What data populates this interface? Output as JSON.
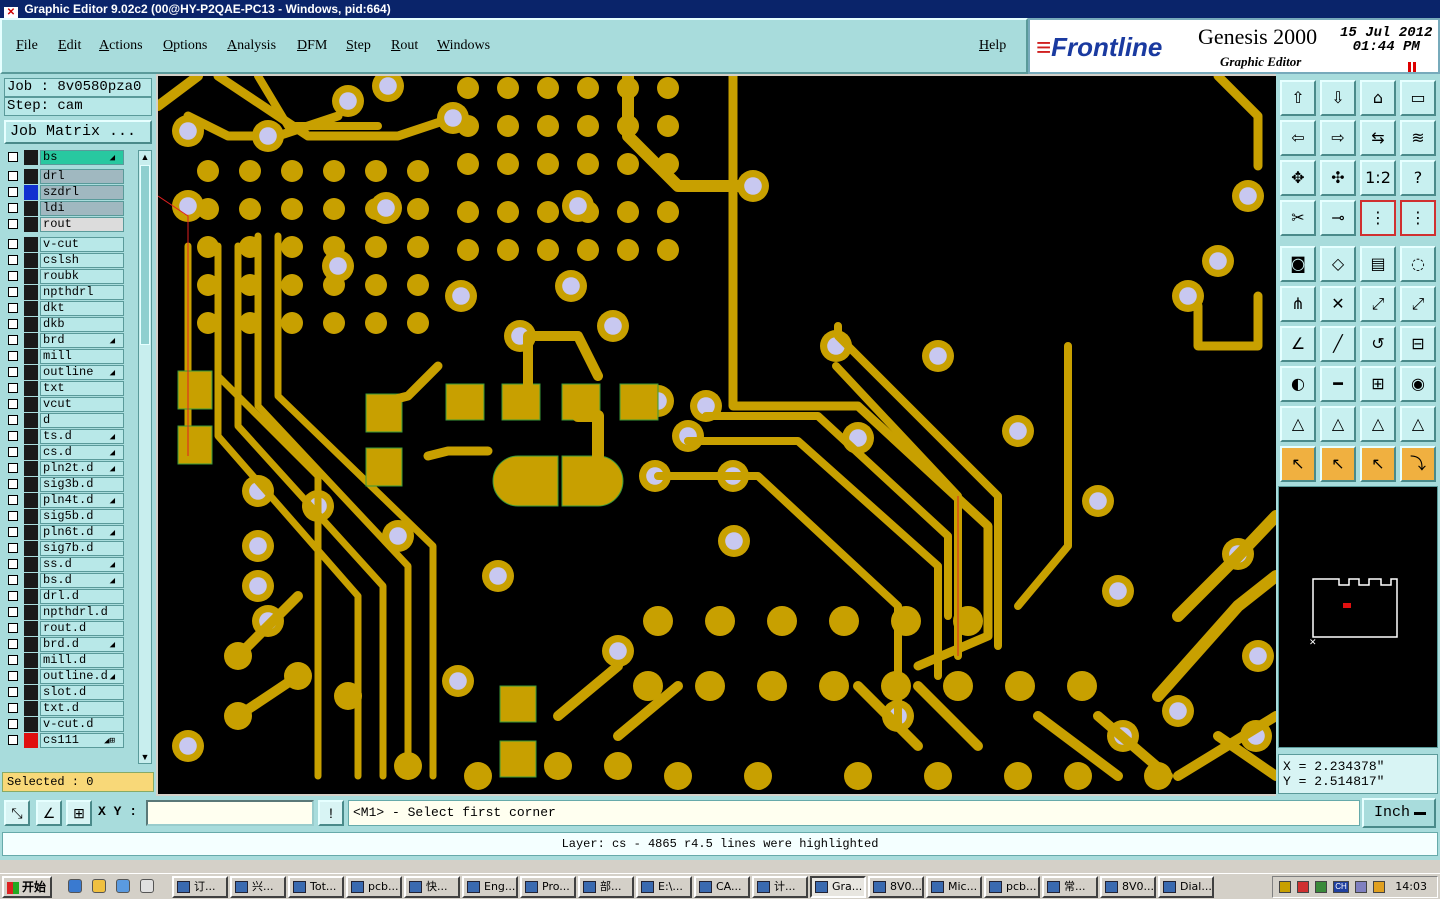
{
  "titlebar": {
    "text": "Graphic Editor 9.02c2 (00@HY-P2QAE-PC13 - Windows, pid:664)"
  },
  "menu": [
    {
      "label": "File"
    },
    {
      "label": "Edit"
    },
    {
      "label": "Actions"
    },
    {
      "label": "Options"
    },
    {
      "label": "Analysis"
    },
    {
      "label": "DFM"
    },
    {
      "label": "Step"
    },
    {
      "label": "Rout"
    },
    {
      "label": "Windows"
    },
    {
      "label": "Help"
    }
  ],
  "brand": {
    "logo": "Frontline",
    "product": "Genesis 2000",
    "subtitle": "Graphic Editor",
    "date": "15 Jul 2012",
    "time": "01:44 PM"
  },
  "job": {
    "job_label": "Job : 8v0580pza0",
    "step_label": "Step: cam",
    "matrix_button": "Job Matrix ..."
  },
  "layers": [
    {
      "name": "bs",
      "color": "#1a1a1a",
      "bg": "#28c8a0",
      "sym": "◢"
    },
    {
      "name": "drl",
      "color": "#1a1a1a",
      "bg": "#a0b8c0"
    },
    {
      "name": "szdrl",
      "color": "#1030d0",
      "bg": "#a0b8c0"
    },
    {
      "name": "ldi",
      "color": "#1a1a1a",
      "bg": "#a0b8c0"
    },
    {
      "name": "rout",
      "color": "#1a1a1a",
      "bg": "#dcdcdc"
    },
    {
      "name": "v-cut",
      "color": "#1a1a1a"
    },
    {
      "name": "cslsh",
      "color": "#1a1a1a"
    },
    {
      "name": "roubk",
      "color": "#1a1a1a"
    },
    {
      "name": "npthdrl",
      "color": "#1a1a1a"
    },
    {
      "name": "dkt",
      "color": "#1a1a1a"
    },
    {
      "name": "dkb",
      "color": "#1a1a1a"
    },
    {
      "name": "brd",
      "color": "#1a1a1a",
      "sym": "◢"
    },
    {
      "name": "mill",
      "color": "#1a1a1a"
    },
    {
      "name": "outline",
      "color": "#1a1a1a",
      "sym": "◢"
    },
    {
      "name": "txt",
      "color": "#1a1a1a"
    },
    {
      "name": "vcut",
      "color": "#1a1a1a"
    },
    {
      "name": "d",
      "color": "#1a1a1a"
    },
    {
      "name": "ts.d",
      "color": "#1a1a1a",
      "sym": "◢"
    },
    {
      "name": "cs.d",
      "color": "#1a1a1a",
      "sym": "◢"
    },
    {
      "name": "pln2t.d",
      "color": "#1a1a1a",
      "sym": "◢"
    },
    {
      "name": "sig3b.d",
      "color": "#1a1a1a"
    },
    {
      "name": "pln4t.d",
      "color": "#1a1a1a",
      "sym": "◢"
    },
    {
      "name": "sig5b.d",
      "color": "#1a1a1a"
    },
    {
      "name": "pln6t.d",
      "color": "#1a1a1a",
      "sym": "◢"
    },
    {
      "name": "sig7b.d",
      "color": "#1a1a1a"
    },
    {
      "name": "ss.d",
      "color": "#1a1a1a",
      "sym": "◢"
    },
    {
      "name": "bs.d",
      "color": "#1a1a1a",
      "sym": "◢"
    },
    {
      "name": "drl.d",
      "color": "#1a1a1a"
    },
    {
      "name": "npthdrl.d",
      "color": "#1a1a1a"
    },
    {
      "name": "rout.d",
      "color": "#1a1a1a"
    },
    {
      "name": "brd.d",
      "color": "#1a1a1a",
      "sym": "◢"
    },
    {
      "name": "mill.d",
      "color": "#1a1a1a"
    },
    {
      "name": "outline.d",
      "color": "#1a1a1a",
      "sym": "◢"
    },
    {
      "name": "slot.d",
      "color": "#1a1a1a"
    },
    {
      "name": "txt.d",
      "color": "#1a1a1a"
    },
    {
      "name": "v-cut.d",
      "color": "#1a1a1a"
    },
    {
      "name": "cs111",
      "color": "#e01010",
      "sym": "◢⊞"
    }
  ],
  "selected": "Selected : 0",
  "coords": {
    "x": "X = 2.234378\"",
    "y": "Y = 2.514817\""
  },
  "bottom": {
    "xy_label": "X Y :",
    "xy_value": "",
    "prompt": "<M1> - Select first corner",
    "unit": "Inch"
  },
  "status": "Layer: cs - 4865 r4.5 lines were highlighted",
  "taskbar": {
    "start": "开始",
    "tasks": [
      {
        "label": "订..."
      },
      {
        "label": "兴..."
      },
      {
        "label": "Tot..."
      },
      {
        "label": "pcb..."
      },
      {
        "label": "快..."
      },
      {
        "label": "Eng..."
      },
      {
        "label": "Pro..."
      },
      {
        "label": "部..."
      },
      {
        "label": "E:\\..."
      },
      {
        "label": "CA..."
      },
      {
        "label": "计..."
      },
      {
        "label": "Gra...",
        "active": true
      },
      {
        "label": "8V0..."
      },
      {
        "label": "Mic..."
      },
      {
        "label": "pcb..."
      },
      {
        "label": "常..."
      },
      {
        "label": "8V0..."
      },
      {
        "label": "Dial..."
      }
    ],
    "tray_lang": "CH",
    "clock": "14:03"
  },
  "colors": {
    "copper": "#c8a000",
    "hole": "#c8c8f0",
    "board": "#000000",
    "panel": "#a8dcdc"
  }
}
